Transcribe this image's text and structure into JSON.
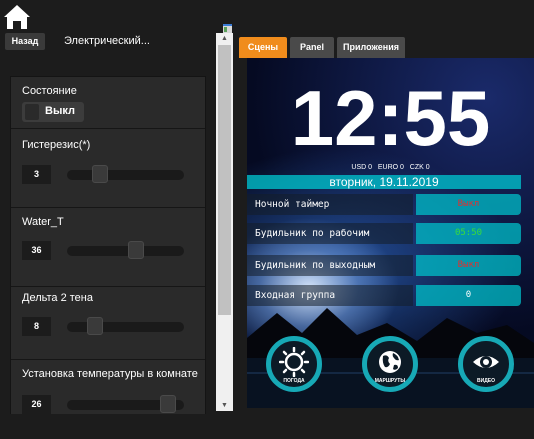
{
  "header": {
    "back_label": "Назад",
    "title": "Электрический..."
  },
  "left_panel": {
    "state": {
      "label": "Состояние",
      "value": "Выкл"
    },
    "hysteresis": {
      "label": "Гистерезис(*)",
      "value": "3",
      "level": 0.25
    },
    "water_t": {
      "label": "Water_T",
      "value": "36",
      "level": 0.6
    },
    "delta": {
      "label": "Дельта 2 тена",
      "value": "8",
      "level": 0.2
    },
    "room_temp": {
      "label": "Установка температуры в комнате",
      "value": "26",
      "level": 0.92
    }
  },
  "tabs": [
    {
      "label": "Сцены",
      "active": true
    },
    {
      "label": "Panel",
      "active": false
    },
    {
      "label": "Приложения",
      "active": false
    }
  ],
  "dashboard": {
    "time": "12:55",
    "currency": {
      "usd": "USD 0",
      "euro": "EURO 0",
      "czk": "CZK 0"
    },
    "date": "вторник, 19.11.2019",
    "rows": [
      {
        "label": "Ночной таймер",
        "value": "Выкл",
        "value_color": "#e03030"
      },
      {
        "label": "Будильник по рабочим",
        "value": "05:50",
        "value_color": "#3adc3a"
      },
      {
        "label": "Будильник по выходным",
        "value": "Выкл",
        "value_color": "#e03030"
      },
      {
        "label": "Входная группа",
        "value": "0",
        "value_color": "#ffffff"
      }
    ],
    "buttons": [
      {
        "label": "ПОГОДА",
        "icon": "sun-icon"
      },
      {
        "label": "МАРШРУТЫ",
        "icon": "globe-icon"
      },
      {
        "label": "ВИДЕО",
        "icon": "eye-icon"
      }
    ]
  },
  "colors": {
    "accent": "#f08c1c",
    "teal": "#17a9b6"
  }
}
